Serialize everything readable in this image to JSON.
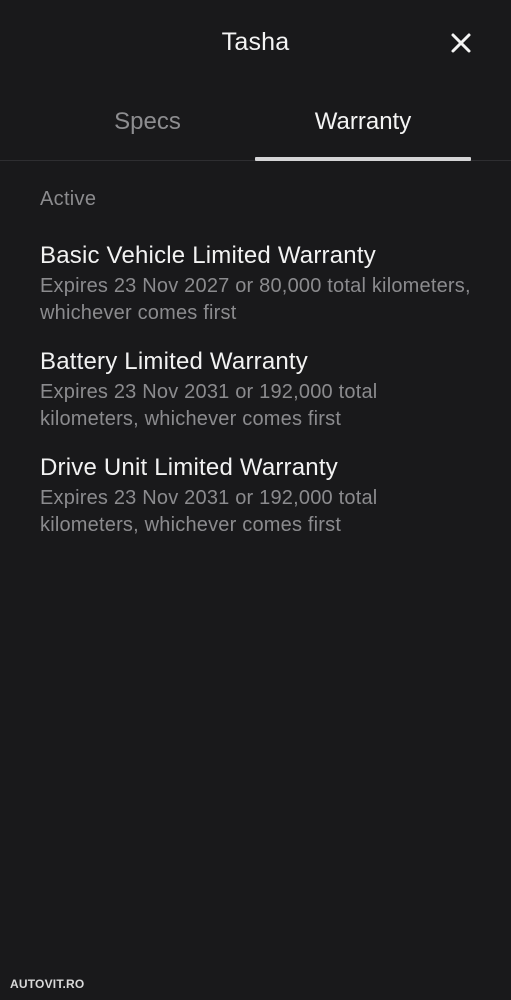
{
  "header": {
    "title": "Tasha",
    "close_icon": "close-icon"
  },
  "tabs": [
    {
      "label": "Specs",
      "active": false
    },
    {
      "label": "Warranty",
      "active": true
    }
  ],
  "section": {
    "label": "Active"
  },
  "warranties": [
    {
      "name": "Basic Vehicle Limited Warranty",
      "description": "Expires 23 Nov 2027 or 80,000 total kilometers, whichever comes first"
    },
    {
      "name": "Battery Limited Warranty",
      "description": "Expires 23 Nov 2031 or 192,000 total kilometers, whichever comes first"
    },
    {
      "name": "Drive Unit Limited Warranty",
      "description": "Expires 23 Nov 2031 or 192,000 total kilometers, whichever comes first"
    }
  ],
  "watermark": "AUTOVIT.RO",
  "colors": {
    "background": "#19191b",
    "primary_text": "#f4f4f4",
    "secondary_text": "#8b8b8e",
    "active_tab_underline": "#d4d4d6"
  }
}
